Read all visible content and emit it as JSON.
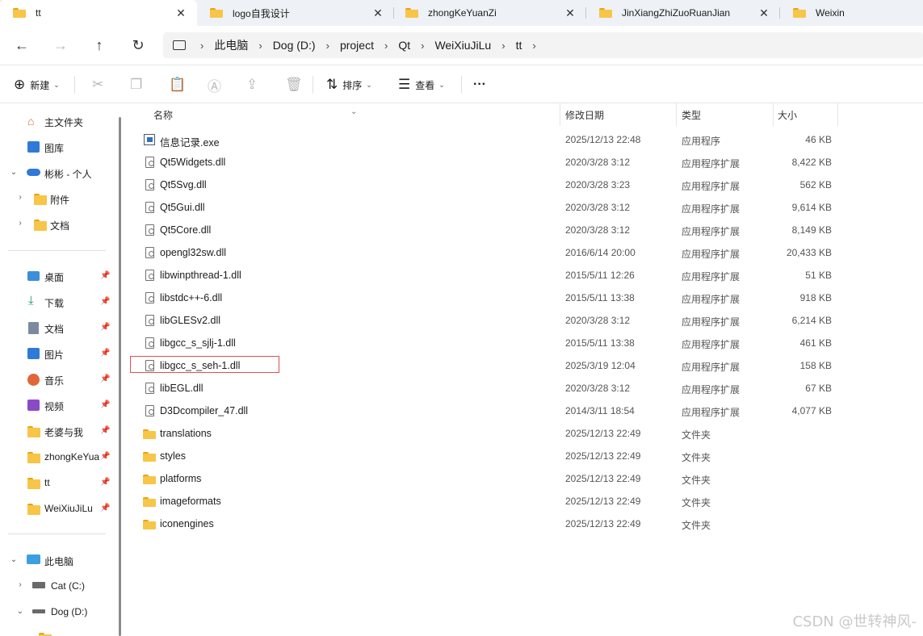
{
  "tabs": [
    {
      "title": "tt",
      "close": "✕",
      "active": true
    },
    {
      "title": "logo自我设计",
      "close": "✕"
    },
    {
      "title": "zhongKeYuanZi",
      "close": "✕"
    },
    {
      "title": "JinXiangZhiZuoRuanJian",
      "close": "✕"
    },
    {
      "title": "Weixin",
      "close": ""
    }
  ],
  "nav": {
    "back": "←",
    "forward": "→",
    "up": "↑",
    "refresh": "↻"
  },
  "breadcrumb": {
    "chev": "›",
    "items": [
      "此电脑",
      "Dog (D:)",
      "project",
      "Qt",
      "WeiXiuJiLu",
      "tt"
    ]
  },
  "commands": {
    "new": "新建",
    "sort": "排序",
    "view": "查看",
    "more": "···"
  },
  "sidebar": {
    "home": "主文件夹",
    "gallery": "图库",
    "onedrive": "彬彬 - 个人",
    "attachments": "附件",
    "documents_cloud": "文档",
    "desktop": "桌面",
    "downloads": "下载",
    "documents": "文档",
    "pictures": "图片",
    "music": "音乐",
    "videos": "视频",
    "laopo": "老婆与我",
    "zhongke": "zhongKeYuanZi",
    "tt": "tt",
    "weixiu": "WeiXiuJiLu",
    "thispc": "此电脑",
    "drive_c": "Cat (C:)",
    "drive_d": "Dog (D:)",
    "pin": "📌"
  },
  "columns": {
    "name": "名称",
    "date": "修改日期",
    "type": "类型",
    "size": "大小"
  },
  "files": [
    {
      "name": "信息记录.exe",
      "date": "2025/12/13 22:48",
      "type": "应用程序",
      "size": "46 KB",
      "kind": "exe"
    },
    {
      "name": "Qt5Widgets.dll",
      "date": "2020/3/28 3:12",
      "type": "应用程序扩展",
      "size": "8,422 KB",
      "kind": "dll"
    },
    {
      "name": "Qt5Svg.dll",
      "date": "2020/3/28 3:23",
      "type": "应用程序扩展",
      "size": "562 KB",
      "kind": "dll"
    },
    {
      "name": "Qt5Gui.dll",
      "date": "2020/3/28 3:12",
      "type": "应用程序扩展",
      "size": "9,614 KB",
      "kind": "dll"
    },
    {
      "name": "Qt5Core.dll",
      "date": "2020/3/28 3:12",
      "type": "应用程序扩展",
      "size": "8,149 KB",
      "kind": "dll"
    },
    {
      "name": "opengl32sw.dll",
      "date": "2016/6/14 20:00",
      "type": "应用程序扩展",
      "size": "20,433 KB",
      "kind": "dll"
    },
    {
      "name": "libwinpthread-1.dll",
      "date": "2015/5/11 12:26",
      "type": "应用程序扩展",
      "size": "51 KB",
      "kind": "dll"
    },
    {
      "name": "libstdc++-6.dll",
      "date": "2015/5/11 13:38",
      "type": "应用程序扩展",
      "size": "918 KB",
      "kind": "dll"
    },
    {
      "name": "libGLESv2.dll",
      "date": "2020/3/28 3:12",
      "type": "应用程序扩展",
      "size": "6,214 KB",
      "kind": "dll"
    },
    {
      "name": "libgcc_s_sjlj-1.dll",
      "date": "2015/5/11 13:38",
      "type": "应用程序扩展",
      "size": "461 KB",
      "kind": "dll"
    },
    {
      "name": "libgcc_s_seh-1.dll",
      "date": "2025/3/19 12:04",
      "type": "应用程序扩展",
      "size": "158 KB",
      "kind": "dll"
    },
    {
      "name": "libEGL.dll",
      "date": "2020/3/28 3:12",
      "type": "应用程序扩展",
      "size": "67 KB",
      "kind": "dll"
    },
    {
      "name": "D3Dcompiler_47.dll",
      "date": "2014/3/11 18:54",
      "type": "应用程序扩展",
      "size": "4,077 KB",
      "kind": "dll"
    },
    {
      "name": "translations",
      "date": "2025/12/13 22:49",
      "type": "文件夹",
      "size": "",
      "kind": "folder"
    },
    {
      "name": "styles",
      "date": "2025/12/13 22:49",
      "type": "文件夹",
      "size": "",
      "kind": "folder"
    },
    {
      "name": "platforms",
      "date": "2025/12/13 22:49",
      "type": "文件夹",
      "size": "",
      "kind": "folder"
    },
    {
      "name": "imageformats",
      "date": "2025/12/13 22:49",
      "type": "文件夹",
      "size": "",
      "kind": "folder"
    },
    {
      "name": "iconengines",
      "date": "2025/12/13 22:49",
      "type": "文件夹",
      "size": "",
      "kind": "folder"
    }
  ],
  "watermark": "CSDN @世转神风-",
  "colors": {
    "folder": "#f7c548",
    "accent": "#2f6fc0",
    "highlight": "#e05050"
  }
}
